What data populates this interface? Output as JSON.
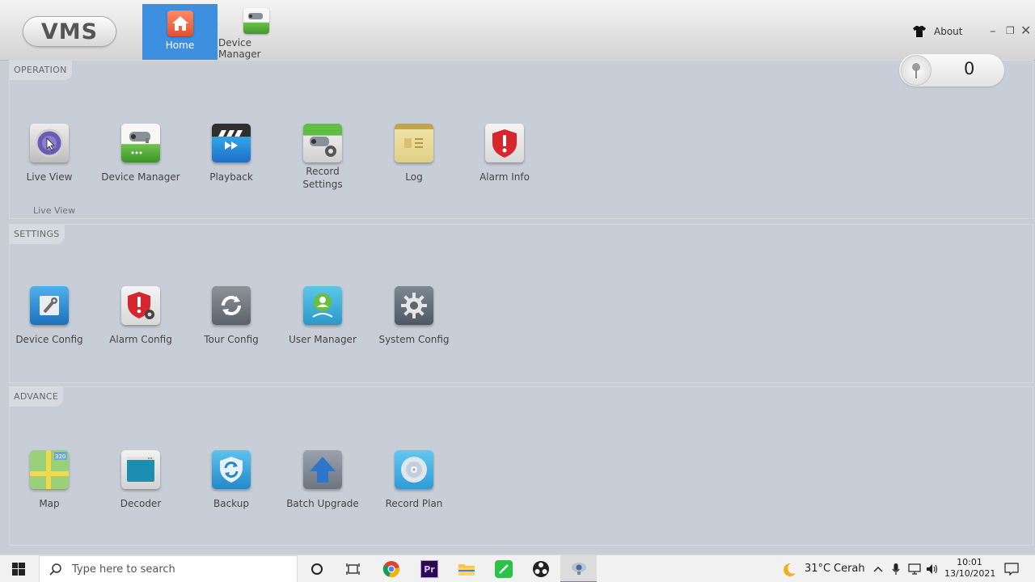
{
  "app": {
    "logo_text": "VMS"
  },
  "topnav": [
    {
      "label": "Home",
      "active": true
    },
    {
      "label": "Device Manager",
      "active": false
    }
  ],
  "window": {
    "about_label": "About"
  },
  "alarm_counter": {
    "value": "0"
  },
  "sections": {
    "operation": {
      "title": "OPERATION",
      "hint": "Live View",
      "items": [
        {
          "label": "Live View",
          "icon": "live-view-icon"
        },
        {
          "label": "Device Manager",
          "icon": "device-manager-icon"
        },
        {
          "label": "Playback",
          "icon": "playback-icon"
        },
        {
          "label": "Record\nSettings",
          "icon": "record-settings-icon"
        },
        {
          "label": "Log",
          "icon": "log-icon"
        },
        {
          "label": "Alarm Info",
          "icon": "alarm-info-icon"
        }
      ]
    },
    "settings": {
      "title": "SETTINGS",
      "items": [
        {
          "label": "Device Config",
          "icon": "device-config-icon"
        },
        {
          "label": "Alarm Config",
          "icon": "alarm-config-icon"
        },
        {
          "label": "Tour Config",
          "icon": "tour-config-icon"
        },
        {
          "label": "User Manager",
          "icon": "user-manager-icon"
        },
        {
          "label": "System Config",
          "icon": "system-config-icon"
        }
      ]
    },
    "advance": {
      "title": "ADVANCE",
      "items": [
        {
          "label": "Map",
          "icon": "map-icon",
          "badge": "320"
        },
        {
          "label": "Decoder",
          "icon": "decoder-icon"
        },
        {
          "label": "Backup",
          "icon": "backup-icon"
        },
        {
          "label": "Batch Upgrade",
          "icon": "batch-upgrade-icon"
        },
        {
          "label": "Record Plan",
          "icon": "record-plan-icon"
        }
      ]
    }
  },
  "taskbar": {
    "search_placeholder": "Type here to search",
    "weather_temp": "31°C",
    "weather_text": "Cerah",
    "time": "10:01",
    "date": "13/10/2021",
    "premiere_label": "Pr"
  }
}
